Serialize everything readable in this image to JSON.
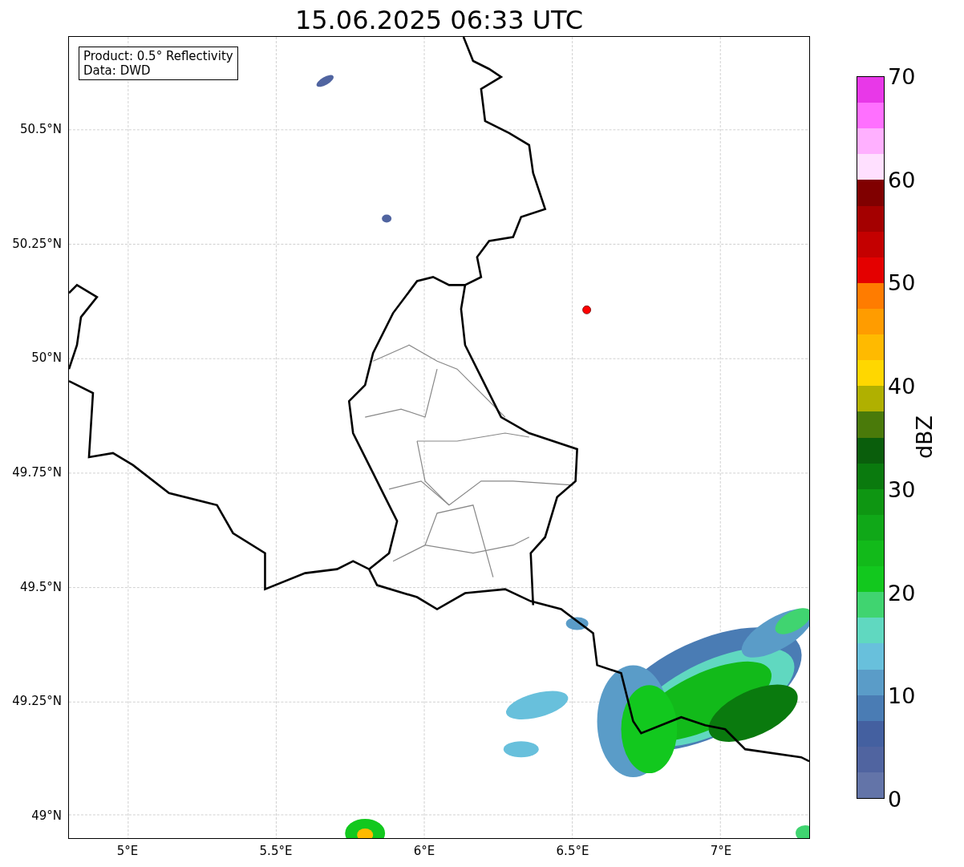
{
  "title": "15.06.2025 06:33 UTC",
  "legend": [
    "Product: 0.5° Reflectivity",
    "Data: DWD"
  ],
  "x_ticks": [
    "5°E",
    "5.5°E",
    "6°E",
    "6.5°E",
    "7°E"
  ],
  "y_ticks": [
    "50.5°N",
    "50.25°N",
    "50°N",
    "49.75°N",
    "49.5°N",
    "49.25°N",
    "49°N"
  ],
  "colorbar": {
    "label": "dBZ",
    "ticks": [
      "70",
      "60",
      "50",
      "40",
      "30",
      "20",
      "10",
      "0"
    ],
    "segments": [
      {
        "color": "#6374a8"
      },
      {
        "color": "#5064a0"
      },
      {
        "color": "#4460a0"
      },
      {
        "color": "#4a7cb4"
      },
      {
        "color": "#5a9cc8"
      },
      {
        "color": "#68c0dc"
      },
      {
        "color": "#60d8c0"
      },
      {
        "color": "#40d470"
      },
      {
        "color": "#12c81e"
      },
      {
        "color": "#12ba1a"
      },
      {
        "color": "#10a818"
      },
      {
        "color": "#0e9612"
      },
      {
        "color": "#0a7a0e"
      },
      {
        "color": "#0a5e0c"
      },
      {
        "color": "#4a7a0a"
      },
      {
        "color": "#b0b000"
      },
      {
        "color": "#ffd700"
      },
      {
        "color": "#ffba00"
      },
      {
        "color": "#ff9c00"
      },
      {
        "color": "#ff7c00"
      },
      {
        "color": "#e40000"
      },
      {
        "color": "#c40000"
      },
      {
        "color": "#a40000"
      },
      {
        "color": "#800000"
      },
      {
        "color": "#ffe0ff"
      },
      {
        "color": "#ffb0ff"
      },
      {
        "color": "#ff70ff"
      },
      {
        "color": "#e838e8"
      }
    ]
  }
}
